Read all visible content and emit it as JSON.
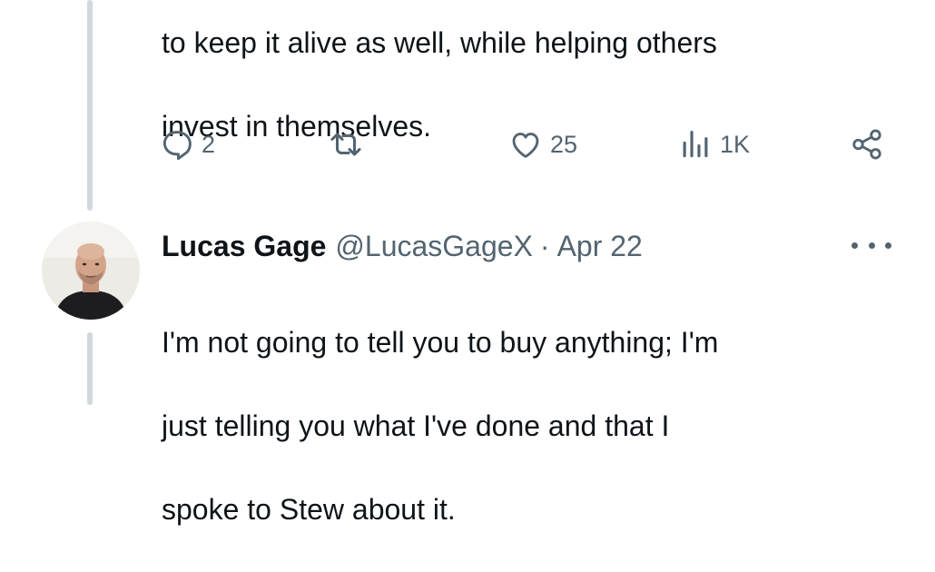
{
  "previous_tweet": {
    "text_lines": [
      "to keep it alive as well, while helping others",
      "invest in themselves."
    ],
    "actions": {
      "reply_count": "2",
      "retweet_count": "",
      "like_count": "25",
      "views_count": "1K"
    }
  },
  "tweet": {
    "display_name": "Lucas Gage",
    "handle": "@LucasGageX",
    "separator": "·",
    "date": "Apr 22",
    "text_lines": [
      "I'm not going to tell you to buy anything; I'm",
      "just telling you what I've done and that I",
      "spoke to Stew about it."
    ]
  },
  "icons": {
    "reply": "reply-icon",
    "retweet": "retweet-icon",
    "like": "heart-icon",
    "views": "views-icon",
    "share": "share-icon",
    "more": "more-icon"
  },
  "colors": {
    "text": "#0f1419",
    "secondary": "#536471",
    "thread_line": "#cfd9de",
    "background": "#ffffff"
  }
}
